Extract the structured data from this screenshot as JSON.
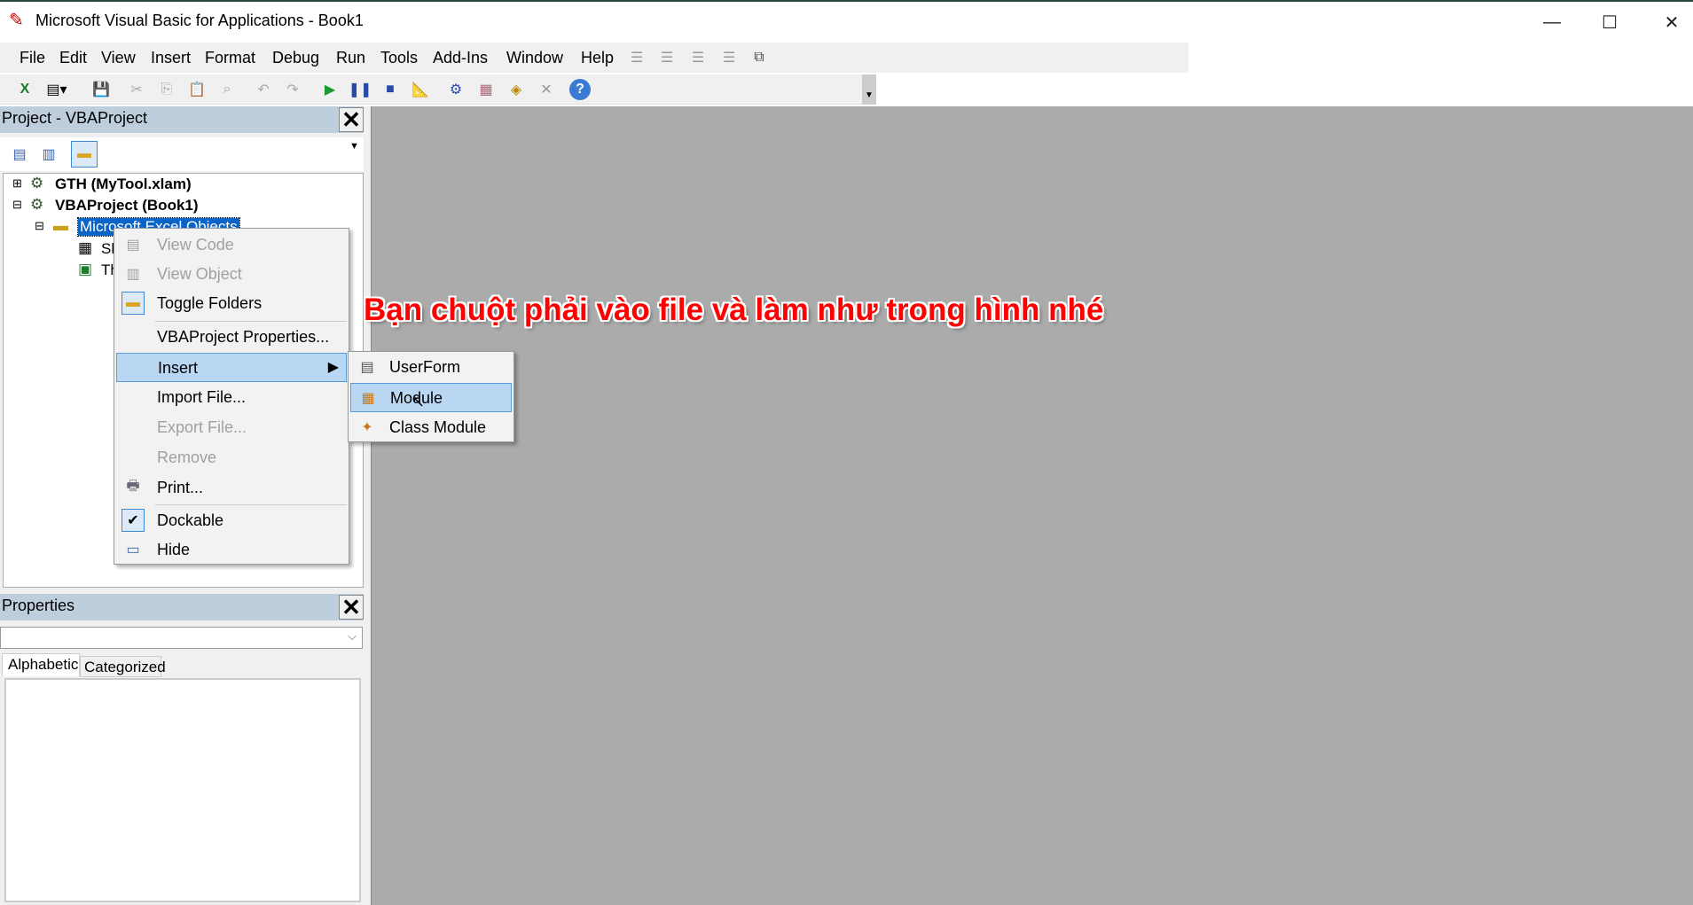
{
  "window": {
    "title": "Microsoft Visual Basic for Applications - Book1",
    "minimize": "—",
    "maximize": "☐",
    "close": "✕"
  },
  "menubar": [
    "File",
    "Edit",
    "View",
    "Insert",
    "Format",
    "Debug",
    "Run",
    "Tools",
    "Add-Ins",
    "Window",
    "Help"
  ],
  "project_panel": {
    "title": "Project - VBAProject",
    "close": "✕",
    "tree": [
      "GTH (MyTool.xlam)",
      "VBAProject (Book1)",
      "Microsoft Excel Objects",
      "Sh",
      "Th"
    ]
  },
  "context_menu": {
    "items": [
      "View Code",
      "View Object",
      "Toggle Folders",
      "VBAProject Properties...",
      "Insert",
      "Import File...",
      "Export File...",
      "Remove",
      "Print...",
      "Dockable",
      "Hide"
    ]
  },
  "insert_submenu": {
    "items": [
      "UserForm",
      "Module",
      "Class Module"
    ]
  },
  "properties_panel": {
    "title": "Properties",
    "close": "✕",
    "tabs": [
      "Alphabetic",
      "Categorized"
    ]
  },
  "annotation": "Bạn chuột phải vào file và làm như trong hình nhé"
}
